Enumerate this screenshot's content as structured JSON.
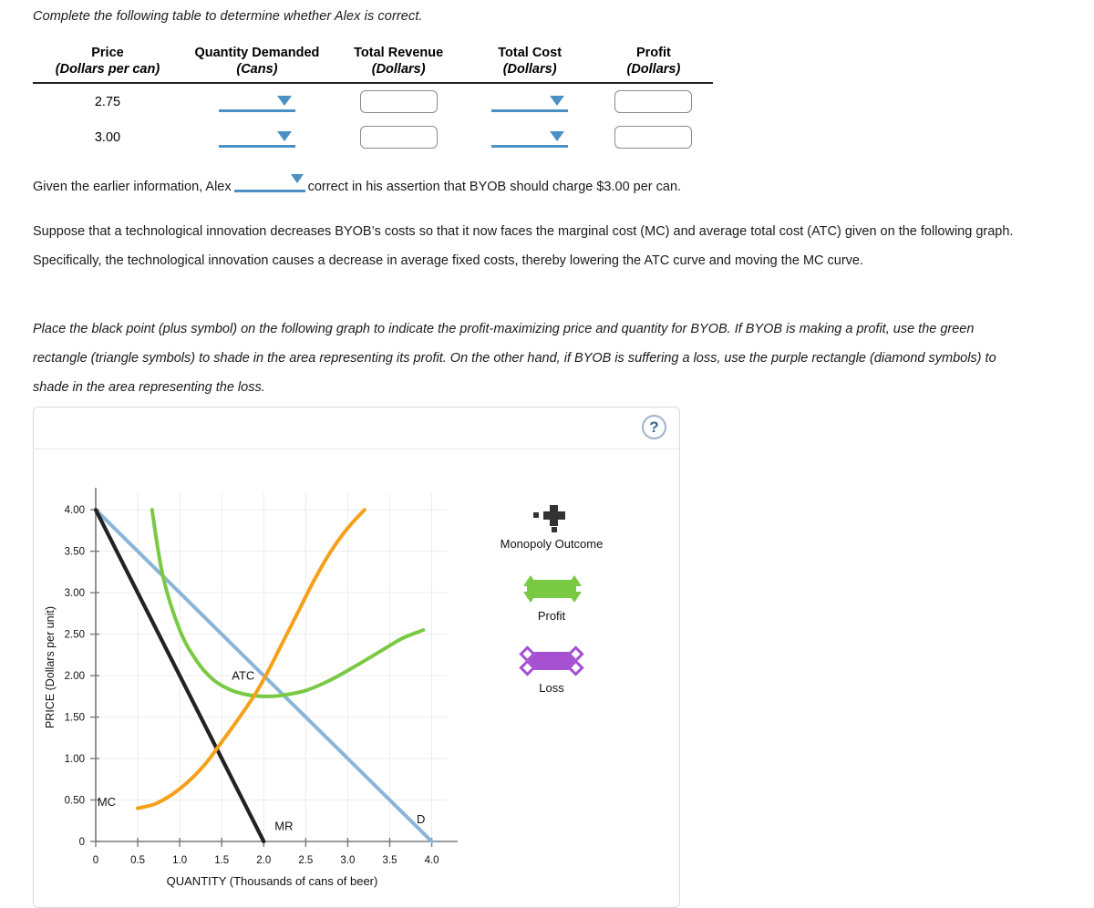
{
  "intro": "Complete the following table to determine whether Alex is correct.",
  "table": {
    "headers_main": [
      "Price",
      "Quantity Demanded",
      "Total Revenue",
      "Total Cost",
      "Profit"
    ],
    "headers_sub": [
      "(Dollars per can)",
      "(Cans)",
      "(Dollars)",
      "(Dollars)",
      "(Dollars)"
    ],
    "rows": [
      {
        "price": "2.75",
        "quantity": "",
        "total_revenue": "",
        "total_cost": "",
        "profit": ""
      },
      {
        "price": "3.00",
        "quantity": "",
        "total_revenue": "",
        "total_cost": "",
        "profit": ""
      }
    ]
  },
  "assertion": {
    "before": "Given the earlier information, Alex",
    "dropdown_value": "",
    "after": "correct in his assertion that BYOB should charge $3.00 per can."
  },
  "paragraph_tech": "Suppose that a technological innovation decreases BYOB’s costs so that it now faces the marginal cost (MC) and average total cost (ATC) given on the following graph. Specifically, the technological innovation causes a decrease in average fixed costs, thereby lowering the ATC curve and moving the MC curve.",
  "paragraph_instructions": "Place the black point (plus symbol) on the following graph to indicate the profit-maximizing price and quantity for BYOB. If BYOB is making a profit, use the green rectangle (triangle symbols) to shade in the area representing its profit. On the other hand, if BYOB is suffering a loss, use the purple rectangle (diamond symbols) to shade in the area representing the loss.",
  "panel": {
    "help_label": "?"
  },
  "legend": {
    "items": [
      {
        "label": "Monopoly Outcome",
        "icon": "plus-point",
        "color": "#333333"
      },
      {
        "label": "Profit",
        "icon": "green-rectangle-triangles",
        "color": "#7ac943"
      },
      {
        "label": "Loss",
        "icon": "purple-rectangle-diamonds",
        "color": "#a54fd1"
      }
    ]
  },
  "chart_data": {
    "type": "line",
    "title": "",
    "xlabel": "QUANTITY (Thousands of cans of beer)",
    "ylabel": "PRICE (Dollars per unit)",
    "xlim": [
      0,
      4.2
    ],
    "ylim": [
      0,
      4.2
    ],
    "xticks": [
      "0",
      "0.5",
      "1.0",
      "1.5",
      "2.0",
      "2.5",
      "3.0",
      "3.5",
      "4.0"
    ],
    "xtick_values": [
      0,
      0.5,
      1.0,
      1.5,
      2.0,
      2.5,
      3.0,
      3.5,
      4.0
    ],
    "yticks": [
      "0",
      "0.50",
      "1.00",
      "1.50",
      "2.00",
      "2.50",
      "3.00",
      "3.50",
      "4.00"
    ],
    "ytick_values": [
      0,
      0.5,
      1.0,
      1.5,
      2.0,
      2.5,
      3.0,
      3.5,
      4.0
    ],
    "grid": true,
    "legend_position": "right",
    "series": [
      {
        "name": "D",
        "label": "D",
        "color": "#8ab4d8",
        "type": "line",
        "points": [
          [
            0,
            4.0
          ],
          [
            4.0,
            0
          ]
        ]
      },
      {
        "name": "MR",
        "label": "MR",
        "color": "#222222",
        "type": "line",
        "points": [
          [
            0,
            4.0
          ],
          [
            2.0,
            0
          ]
        ]
      },
      {
        "name": "ATC",
        "label": "ATC",
        "color": "#7ac943",
        "type": "curve",
        "points": [
          [
            0.67,
            4.0
          ],
          [
            0.8,
            3.2
          ],
          [
            1.0,
            2.55
          ],
          [
            1.2,
            2.18
          ],
          [
            1.4,
            1.95
          ],
          [
            1.6,
            1.83
          ],
          [
            1.8,
            1.77
          ],
          [
            2.0,
            1.75
          ],
          [
            2.2,
            1.76
          ],
          [
            2.5,
            1.82
          ],
          [
            2.8,
            1.95
          ],
          [
            3.1,
            2.12
          ],
          [
            3.4,
            2.3
          ],
          [
            3.65,
            2.45
          ],
          [
            3.9,
            2.55
          ]
        ]
      },
      {
        "name": "MC",
        "label": "MC",
        "color": "#f6a01a",
        "type": "curve",
        "points": [
          [
            0.5,
            0.4
          ],
          [
            0.7,
            0.45
          ],
          [
            0.9,
            0.56
          ],
          [
            1.1,
            0.72
          ],
          [
            1.3,
            0.93
          ],
          [
            1.5,
            1.2
          ],
          [
            1.7,
            1.48
          ],
          [
            1.9,
            1.78
          ],
          [
            2.05,
            2.05
          ],
          [
            2.2,
            2.35
          ],
          [
            2.4,
            2.75
          ],
          [
            2.6,
            3.15
          ],
          [
            2.8,
            3.5
          ],
          [
            3.0,
            3.78
          ],
          [
            3.2,
            4.0
          ]
        ]
      }
    ],
    "annotations": [
      {
        "text": "ATC",
        "x": 1.62,
        "y": 1.95
      },
      {
        "text": "MC",
        "x": 0.02,
        "y": 0.43
      },
      {
        "text": "MR",
        "x": 2.13,
        "y": 0.14
      },
      {
        "text": "D",
        "x": 3.82,
        "y": 0.22
      }
    ]
  }
}
